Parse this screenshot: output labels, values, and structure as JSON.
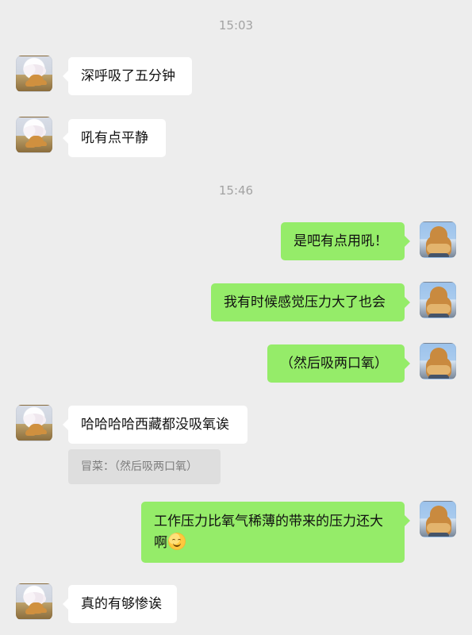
{
  "timestamps": [
    "15:03",
    "15:46"
  ],
  "messages": [
    {
      "side": "left",
      "text": "深呼吸了五分钟"
    },
    {
      "side": "left",
      "text": "吼有点平静"
    },
    {
      "side": "right",
      "text": "是吧有点用吼！"
    },
    {
      "side": "right",
      "text": "我有时候感觉压力大了也会"
    },
    {
      "side": "right",
      "text": "（然后吸两口氧）"
    },
    {
      "side": "left",
      "text": "哈哈哈哈西藏都没吸氧诶"
    },
    {
      "side": "right",
      "text_line1": "工作压力比氧气稀薄的带来的压力还大",
      "text_line2": "啊"
    },
    {
      "side": "left",
      "text": "真的有够惨诶"
    }
  ],
  "quote": {
    "text": "冒菜：（然后吸两口氧）"
  },
  "icons": {
    "left_avatar": "dog-avatar-icon",
    "right_avatar": "golden-retriever-avatar-icon",
    "emoji": "smiling-face-emoji"
  },
  "colors": {
    "background": "#ededed",
    "left_bubble": "#ffffff",
    "right_bubble": "#95ec69",
    "quote_bg": "#dedede",
    "timestamp": "#a3a3a3"
  }
}
